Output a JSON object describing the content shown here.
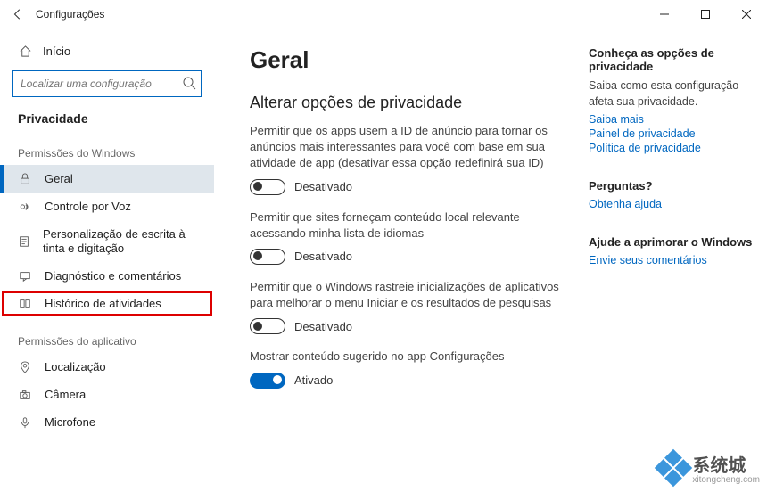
{
  "window": {
    "title": "Configurações"
  },
  "sidebar": {
    "home": "Início",
    "search_placeholder": "Localizar uma configuração",
    "section": "Privacidade",
    "group1": "Permissões do Windows",
    "items1": [
      {
        "label": "Geral",
        "icon": "lock"
      },
      {
        "label": "Controle por Voz",
        "icon": "voice"
      },
      {
        "label": "Personalização de escrita à tinta e digitação",
        "icon": "clipboard"
      },
      {
        "label": "Diagnóstico e comentários",
        "icon": "feedback"
      },
      {
        "label": "Histórico de atividades",
        "icon": "history"
      }
    ],
    "group2": "Permissões do aplicativo",
    "items2": [
      {
        "label": "Localização",
        "icon": "location"
      },
      {
        "label": "Câmera",
        "icon": "camera"
      },
      {
        "label": "Microfone",
        "icon": "microphone"
      }
    ]
  },
  "main": {
    "title": "Geral",
    "subtitle": "Alterar opções de privacidade",
    "settings": [
      {
        "desc": "Permitir que os apps usem a ID de anúncio para tornar os anúncios mais interessantes para você com base em sua atividade de app (desativar essa opção redefinirá sua ID)",
        "on": false,
        "label": "Desativado"
      },
      {
        "desc": "Permitir que sites forneçam conteúdo local relevante acessando minha lista de idiomas",
        "on": false,
        "label": "Desativado"
      },
      {
        "desc": "Permitir que o Windows rastreie inicializações de aplicativos para melhorar o menu Iniciar e os resultados de pesquisas",
        "on": false,
        "label": "Desativado"
      },
      {
        "desc": "Mostrar conteúdo sugerido no app Configurações",
        "on": true,
        "label": "Ativado"
      }
    ]
  },
  "right": {
    "sec1_title": "Conheça as opções de privacidade",
    "sec1_desc": "Saiba como esta configuração afeta sua privacidade.",
    "sec1_links": [
      "Saiba mais",
      "Painel de privacidade",
      "Política de privacidade"
    ],
    "sec2_title": "Perguntas?",
    "sec2_links": [
      "Obtenha ajuda"
    ],
    "sec3_title": "Ajude a aprimorar o Windows",
    "sec3_links": [
      "Envie seus comentários"
    ]
  },
  "watermark": {
    "text": "系统城",
    "url": "xitongcheng.com"
  }
}
